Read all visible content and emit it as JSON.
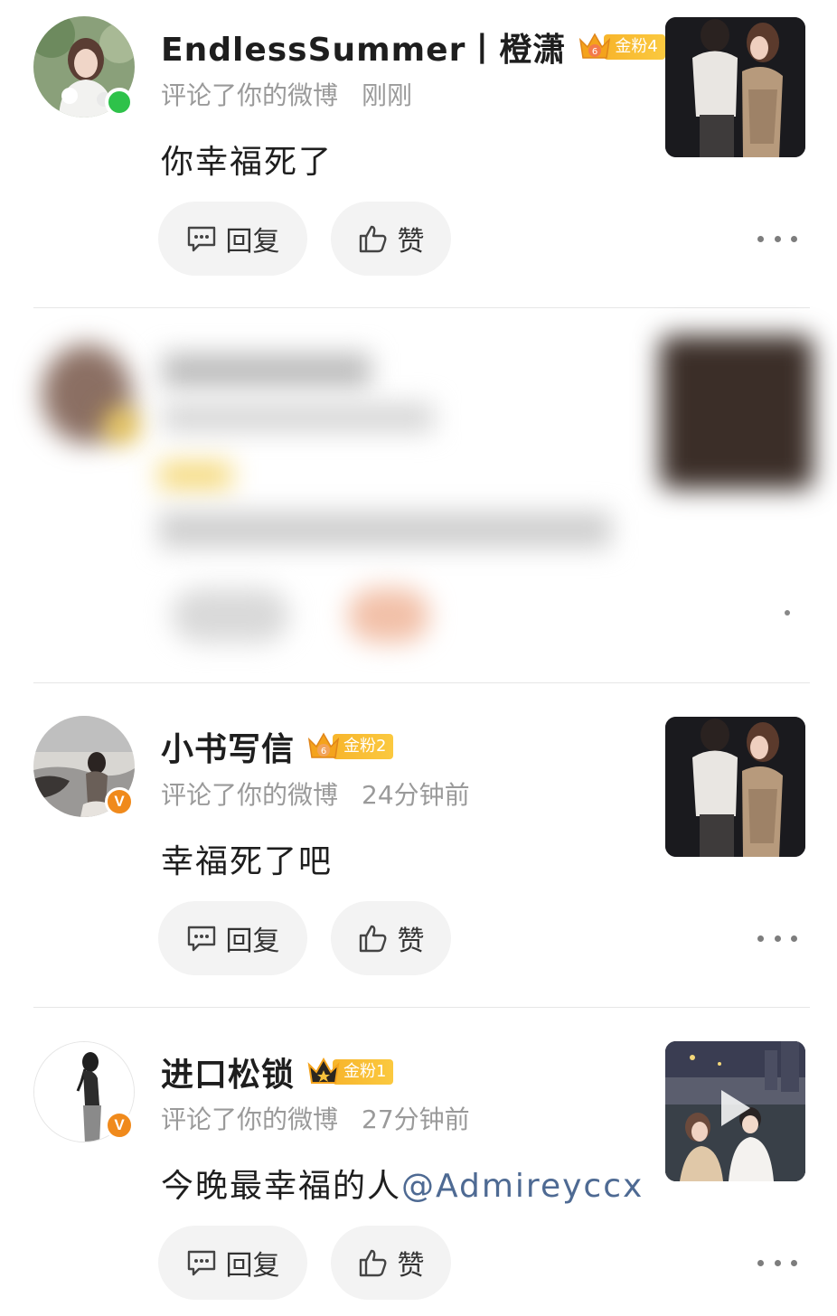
{
  "colors": {
    "online": "#2ec24a",
    "verified": "#f08a1c",
    "fan_badge": "#f7b52c",
    "mention": "#4e6a93",
    "meta": "#9a9a9a"
  },
  "actions": {
    "reply_label": "回复",
    "like_label": "赞"
  },
  "notifications": [
    {
      "username": "EndlessSummer丨橙潇",
      "fan_level": "金粉4",
      "crown_level": "6",
      "action": "评论了你的微博",
      "time": "刚刚",
      "comment": "你幸福死了",
      "status_icon": "online-dot"
    },
    {
      "blurred": true
    },
    {
      "username": "小书写信",
      "fan_level": "金粉2",
      "crown_level": "6",
      "action": "评论了你的微博",
      "time": "24分钟前",
      "comment": "幸福死了吧",
      "status_icon": "verified-v-icon",
      "verified_mark": "V"
    },
    {
      "username": "进口松锁",
      "fan_level": "金粉1",
      "action": "评论了你的微博",
      "time": "27分钟前",
      "comment": "今晚最幸福的人",
      "mention": "@Admireyccx",
      "status_icon": "verified-v-icon",
      "verified_mark": "V",
      "thumbnail_icon": "play-icon"
    }
  ]
}
